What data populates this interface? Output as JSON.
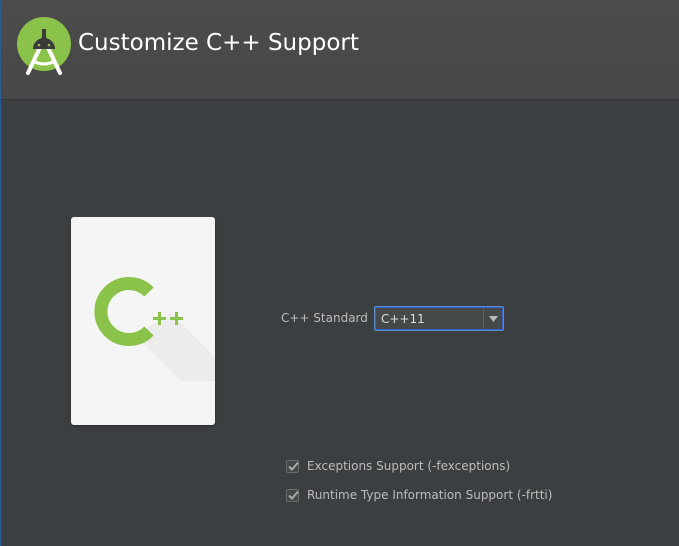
{
  "header": {
    "title": "Customize C++ Support",
    "logo_icon": "android-studio-logo-icon"
  },
  "illustration": {
    "icon": "cpp-logo-icon",
    "letter": "C",
    "plus": "++"
  },
  "form": {
    "standard_label": "C++ Standard",
    "standard_value": "C++11",
    "dropdown_icon": "chevron-down-icon"
  },
  "options": [
    {
      "label": "Exceptions Support (-fexceptions)",
      "checked": true
    },
    {
      "label": "Runtime Type Information Support (-frtti)",
      "checked": true
    }
  ],
  "colors": {
    "background": "#3c3f41",
    "header_bg": "#4a4a4a",
    "android_green": "#8bc34a",
    "cpp_green": "#8bc34a",
    "focus_blue": "#5b8cc8"
  }
}
